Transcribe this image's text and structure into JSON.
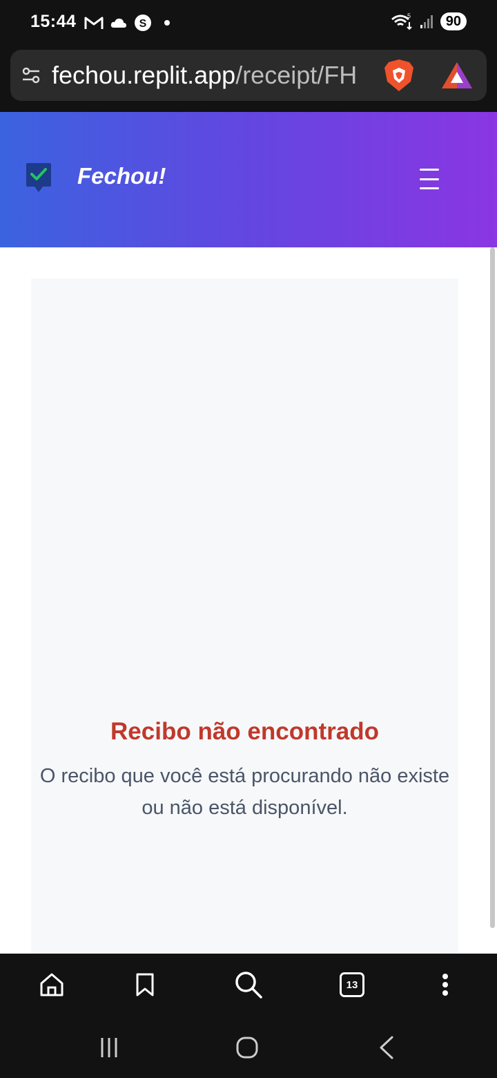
{
  "status": {
    "time": "15:44",
    "battery": "90",
    "signal_label": "5"
  },
  "browser": {
    "url_host": "fechou.replit.app",
    "url_path": "/receipt/FH",
    "tabs_count": "13"
  },
  "app": {
    "brand": "Fechou!"
  },
  "page": {
    "error_title": "Recibo não encontrado",
    "error_message": "O recibo que você está procurando não existe ou não está disponível."
  },
  "colors": {
    "header_gradient_start": "#3b63e0",
    "header_gradient_end": "#8a36e2",
    "error_title": "#c0392b",
    "message_text": "#4a5568"
  },
  "icons": {
    "status_left": [
      "gmail-icon",
      "cloud-icon",
      "s-app-icon",
      "dot-icon"
    ],
    "status_right": [
      "wifi-icon",
      "signal-icon",
      "battery-icon"
    ],
    "toolbar": [
      "home-icon",
      "bookmark-icon",
      "search-icon",
      "tabs-icon",
      "more-icon"
    ],
    "system_nav": [
      "recents-icon",
      "home-nav-icon",
      "back-icon"
    ]
  }
}
